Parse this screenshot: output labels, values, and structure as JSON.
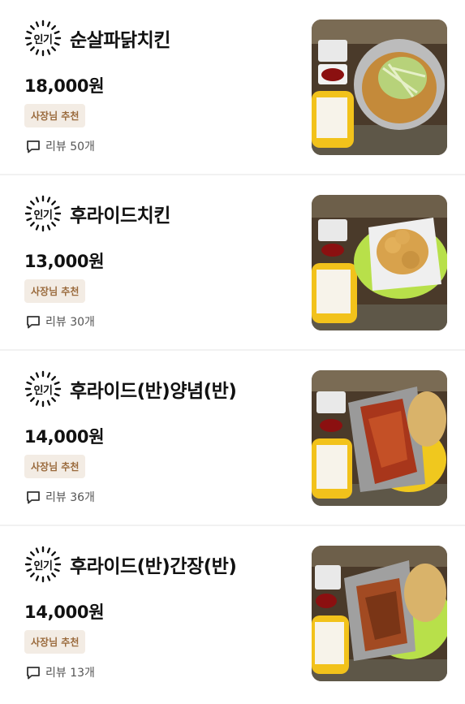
{
  "items": [
    {
      "popular": "인기",
      "name": "순살파닭치킨",
      "price": "18,000원",
      "badge": "사장님 추천",
      "review": "리뷰 50개"
    },
    {
      "popular": "인기",
      "name": "후라이드치킨",
      "price": "13,000원",
      "badge": "사장님 추천",
      "review": "리뷰 30개"
    },
    {
      "popular": "인기",
      "name": "후라이드(반)양념(반)",
      "price": "14,000원",
      "badge": "사장님 추천",
      "review": "리뷰 36개"
    },
    {
      "popular": "인기",
      "name": "후라이드(반)간장(반)",
      "price": "14,000원",
      "badge": "사장님 추천",
      "review": "리뷰 13개"
    }
  ],
  "colors": {
    "badge_bg": "#f3ece4",
    "badge_text": "#9a6a3c"
  },
  "icons": {
    "popular": "sunburst-icon",
    "review": "speech-bubble-icon"
  }
}
